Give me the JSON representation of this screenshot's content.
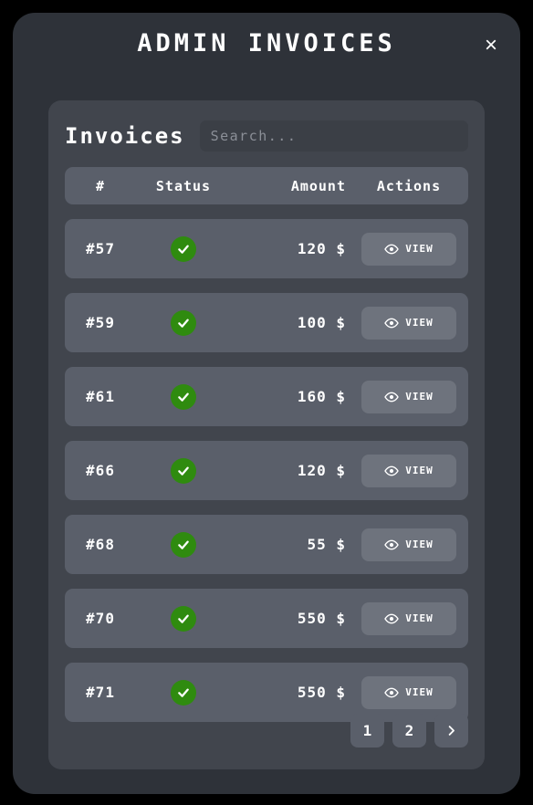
{
  "modal": {
    "title": "ADMIN INVOICES",
    "close_label": "×"
  },
  "card": {
    "title": "Invoices",
    "search": {
      "placeholder": "Search...",
      "value": ""
    }
  },
  "table": {
    "columns": [
      "#",
      "Status",
      "Amount",
      "Actions"
    ],
    "rows": [
      {
        "number": "#57",
        "status": "paid",
        "amount": "120 $",
        "action_label": "VIEW"
      },
      {
        "number": "#59",
        "status": "paid",
        "amount": "100 $",
        "action_label": "VIEW"
      },
      {
        "number": "#61",
        "status": "paid",
        "amount": "160 $",
        "action_label": "VIEW"
      },
      {
        "number": "#66",
        "status": "paid",
        "amount": "120 $",
        "action_label": "VIEW"
      },
      {
        "number": "#68",
        "status": "paid",
        "amount": "55 $",
        "action_label": "VIEW"
      },
      {
        "number": "#70",
        "status": "paid",
        "amount": "550 $",
        "action_label": "VIEW"
      },
      {
        "number": "#71",
        "status": "paid",
        "amount": "550 $",
        "action_label": "VIEW"
      }
    ]
  },
  "pagination": {
    "pages": [
      "1",
      "2"
    ],
    "next_icon": "chevron-right-icon"
  },
  "icons": {
    "status": "check-icon",
    "action": "eye-icon",
    "close": "close-icon"
  },
  "colors": {
    "page_background": "#000000",
    "modal_background": "#2e3239",
    "card_background": "#41454d",
    "row_background": "#5a5f6a",
    "button_background": "#6e737d",
    "status_green": "#2f8b0f",
    "text_primary": "#ffffff",
    "placeholder": "#8b8f97"
  }
}
